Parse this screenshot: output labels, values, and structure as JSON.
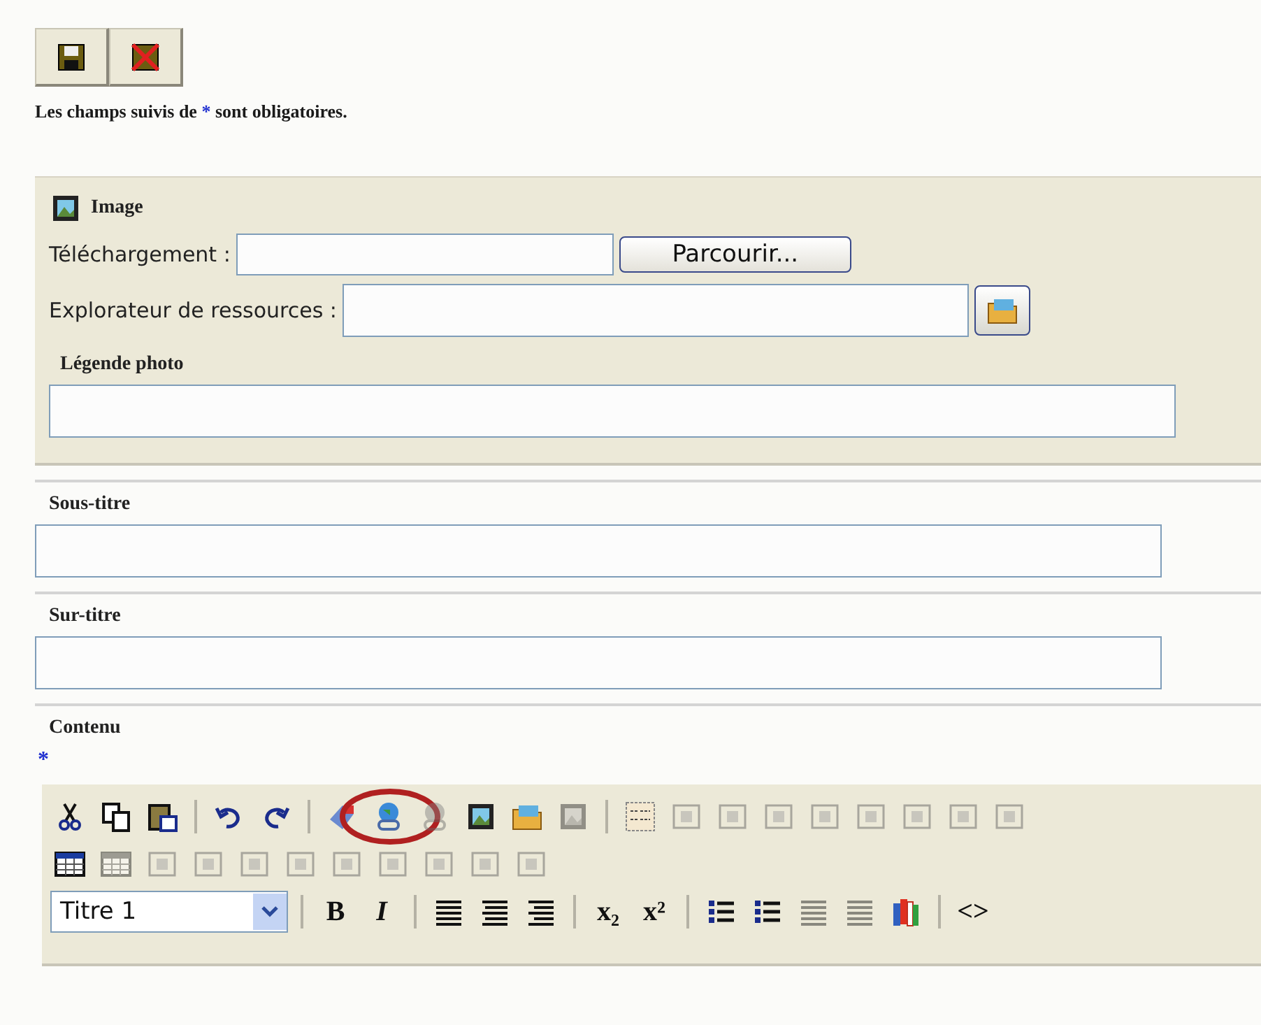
{
  "actions": [
    {
      "kind": "button"
    },
    {
      "kind": "button"
    }
  ],
  "notice": {
    "before": "Les champs suivis de",
    "mark": "*",
    "after": "sont obligatoires."
  },
  "image_panel": {
    "title": "Image",
    "upload_label": "Téléchargement :",
    "browse_button": "Parcourir...",
    "explorer_label": "Explorateur de ressources :",
    "caption_label": "Légende photo"
  },
  "fields": [
    {
      "label": "Sous-titre"
    },
    {
      "label": "Sur-titre"
    }
  ],
  "content": {
    "label": "Contenu",
    "required_mark": "*"
  },
  "toolbar_rows": [
    [
      {
        "kind": "button",
        "disabled": false
      },
      {
        "kind": "button",
        "disabled": false
      },
      {
        "kind": "button",
        "disabled": false
      },
      {
        "kind": "separator"
      },
      {
        "kind": "button",
        "disabled": false
      },
      {
        "kind": "button",
        "disabled": false
      },
      {
        "kind": "separator"
      },
      {
        "kind": "button",
        "disabled": false
      },
      {
        "kind": "button",
        "disabled": false,
        "highlighted": true
      },
      {
        "kind": "button",
        "disabled": true
      },
      {
        "kind": "button",
        "disabled": false
      },
      {
        "kind": "button",
        "disabled": false
      },
      {
        "kind": "button",
        "disabled": true
      },
      {
        "kind": "separator"
      },
      {
        "kind": "button",
        "disabled": false
      },
      {
        "kind": "button",
        "disabled": true
      },
      {
        "kind": "button",
        "disabled": true
      },
      {
        "kind": "button",
        "disabled": true
      },
      {
        "kind": "button",
        "disabled": true
      },
      {
        "kind": "button",
        "disabled": true
      },
      {
        "kind": "button",
        "disabled": true
      },
      {
        "kind": "button",
        "disabled": true
      },
      {
        "kind": "button",
        "disabled": true
      }
    ],
    [
      {
        "kind": "button",
        "disabled": false
      },
      {
        "kind": "button",
        "disabled": true
      },
      {
        "kind": "button",
        "disabled": true
      },
      {
        "kind": "button",
        "disabled": true
      },
      {
        "kind": "button",
        "disabled": true
      },
      {
        "kind": "button",
        "disabled": true
      },
      {
        "kind": "button",
        "disabled": true
      },
      {
        "kind": "button",
        "disabled": true
      },
      {
        "kind": "button",
        "disabled": true
      },
      {
        "kind": "button",
        "disabled": true
      },
      {
        "kind": "button",
        "disabled": true
      }
    ],
    [
      {
        "kind": "select",
        "value": "Titre 1"
      },
      {
        "kind": "separator"
      },
      {
        "kind": "text",
        "text": "B"
      },
      {
        "kind": "text",
        "text": "I"
      },
      {
        "kind": "separator"
      },
      {
        "kind": "button",
        "disabled": false
      },
      {
        "kind": "button",
        "disabled": false
      },
      {
        "kind": "button",
        "disabled": false
      },
      {
        "kind": "separator"
      },
      {
        "kind": "text",
        "text": "x₂"
      },
      {
        "kind": "text",
        "text": "x²"
      },
      {
        "kind": "separator"
      },
      {
        "kind": "button",
        "disabled": false
      },
      {
        "kind": "button",
        "disabled": false
      },
      {
        "kind": "button",
        "disabled": true
      },
      {
        "kind": "button",
        "disabled": true
      },
      {
        "kind": "button",
        "disabled": false
      },
      {
        "kind": "separator"
      },
      {
        "kind": "text",
        "text": "<>"
      }
    ]
  ]
}
